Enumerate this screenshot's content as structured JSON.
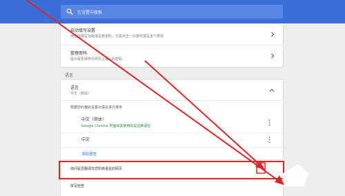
{
  "search": {
    "placeholder": "在设置中搜索"
  },
  "autofill": {
    "address": {
      "title": "自动填写设置",
      "subtitle": "用自动填写功能填写表单时，只需点击一次即可填写多个表单"
    },
    "passwords": {
      "title": "管理密码",
      "subtitle": "提示是否保存在网页上输入的密码"
    }
  },
  "languages": {
    "section_title": "语言",
    "header": {
      "title": "语言",
      "current": "中文（简体）"
    },
    "order_hint": "根据您的偏好设置对语言进行排序",
    "items": [
      {
        "name": "中文（简体）",
        "note": "Google Chrome 界面目前使用的是这种语言"
      },
      {
        "name": "中文"
      }
    ],
    "add_link": "添加语言",
    "translate_offer": "询问是否翻译非您所用语言的网页",
    "spellcheck": "拼写检查"
  },
  "colors": {
    "topbar": "#3b6fd8",
    "search_bg": "#5a87e6",
    "annotation": "#e02424",
    "link": "#1a73e8",
    "green_note": "#1e8e3e"
  },
  "icons": [
    "search-icon",
    "chevron-right-icon",
    "chevron-up-icon",
    "more-vert-icon"
  ]
}
